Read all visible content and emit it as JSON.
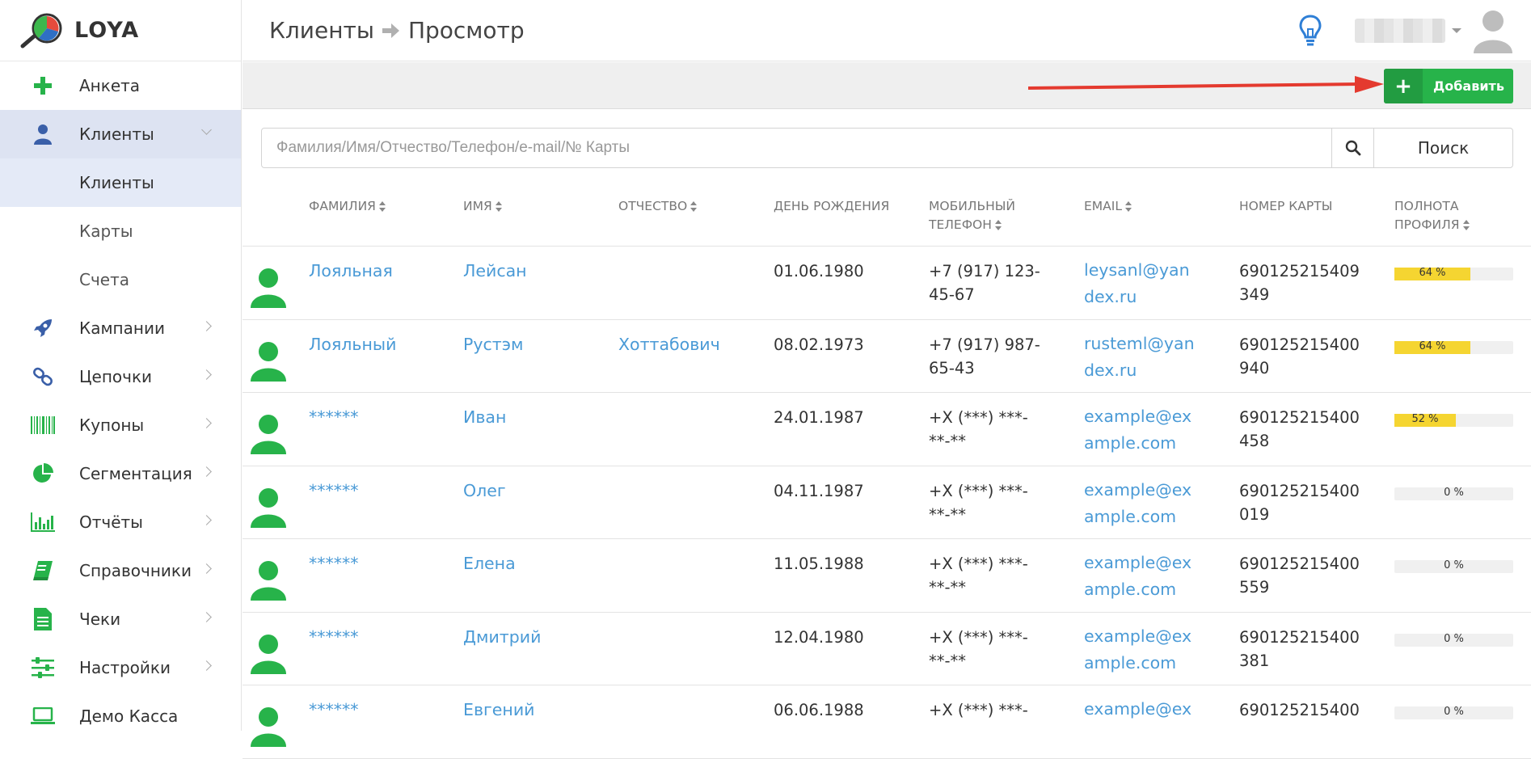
{
  "app": {
    "name": "LOYA"
  },
  "sidebar": {
    "items": [
      {
        "label": "Анкета",
        "icon": "plus-icon"
      },
      {
        "label": "Клиенты",
        "icon": "user-icon"
      },
      {
        "label": "Кампании",
        "icon": "rocket-icon"
      },
      {
        "label": "Цепочки",
        "icon": "chain-icon"
      },
      {
        "label": "Купоны",
        "icon": "barcode-icon"
      },
      {
        "label": "Сегментация",
        "icon": "pie-chart-icon"
      },
      {
        "label": "Отчёты",
        "icon": "bar-chart-icon"
      },
      {
        "label": "Справочники",
        "icon": "book-icon"
      },
      {
        "label": "Чеки",
        "icon": "receipt-icon"
      },
      {
        "label": "Настройки",
        "icon": "sliders-icon"
      },
      {
        "label": "Демо Касса",
        "icon": "laptop-icon"
      }
    ],
    "sub": [
      {
        "label": "Клиенты"
      },
      {
        "label": "Карты"
      },
      {
        "label": "Счета"
      }
    ]
  },
  "header": {
    "crumb1": "Клиенты",
    "crumb2": "Просмотр"
  },
  "toolbar": {
    "add_label": "Добавить"
  },
  "search": {
    "placeholder": "Фамилия/Имя/Отчество/Телефон/e-mail/№ Карты",
    "button": "Поиск"
  },
  "table": {
    "headers": {
      "lastname": "ФАМИЛИЯ",
      "firstname": "ИМЯ",
      "patronymic": "ОТЧЕСТВО",
      "birthday": "ДЕНЬ РОЖДЕНИЯ",
      "phone1": "МОБИЛЬНЫЙ",
      "phone2": "ТЕЛЕФОН",
      "email": "EMAIL",
      "card": "НОМЕР КАРТЫ",
      "profile1": "ПОЛНОТА",
      "profile2": "ПРОФИЛЯ"
    },
    "rows": [
      {
        "lastname": "Лояльная",
        "firstname": "Лейсан",
        "patronymic": "",
        "birthday": "01.06.1980",
        "phone1": "+7 (917) 123-",
        "phone2": "45-67",
        "email1": "leysanl@yan",
        "email2": "dex.ru",
        "card1": "690125215409",
        "card2": "349",
        "profile": 64,
        "profile_label": "64 %"
      },
      {
        "lastname": "Лояльный",
        "firstname": "Рустэм",
        "patronymic": "Хоттабович",
        "birthday": "08.02.1973",
        "phone1": "+7 (917) 987-",
        "phone2": "65-43",
        "email1": "rusteml@yan",
        "email2": "dex.ru",
        "card1": "690125215400",
        "card2": "940",
        "profile": 64,
        "profile_label": "64 %"
      },
      {
        "lastname": "******",
        "firstname": "Иван",
        "patronymic": "",
        "birthday": "24.01.1987",
        "phone1": "+X (***) ***-",
        "phone2": "**-**",
        "email1": "example@ex",
        "email2": "ample.com",
        "card1": "690125215400",
        "card2": "458",
        "profile": 52,
        "profile_label": "52 %"
      },
      {
        "lastname": "******",
        "firstname": "Олег",
        "patronymic": "",
        "birthday": "04.11.1987",
        "phone1": "+X (***) ***-",
        "phone2": "**-**",
        "email1": "example@ex",
        "email2": "ample.com",
        "card1": "690125215400",
        "card2": "019",
        "profile": 0,
        "profile_label": "0 %"
      },
      {
        "lastname": "******",
        "firstname": "Елена",
        "patronymic": "",
        "birthday": "11.05.1988",
        "phone1": "+X (***) ***-",
        "phone2": "**-**",
        "email1": "example@ex",
        "email2": "ample.com",
        "card1": "690125215400",
        "card2": "559",
        "profile": 0,
        "profile_label": "0 %"
      },
      {
        "lastname": "******",
        "firstname": "Дмитрий",
        "patronymic": "",
        "birthday": "12.04.1980",
        "phone1": "+X (***) ***-",
        "phone2": "**-**",
        "email1": "example@ex",
        "email2": "ample.com",
        "card1": "690125215400",
        "card2": "381",
        "profile": 0,
        "profile_label": "0 %"
      },
      {
        "lastname": "******",
        "firstname": "Евгений",
        "patronymic": "",
        "birthday": "06.06.1988",
        "phone1": "+X (***) ***-",
        "phone2": "",
        "email1": "example@ex",
        "email2": "",
        "card1": "690125215400",
        "card2": "",
        "profile": 0,
        "profile_label": "0 %"
      }
    ]
  },
  "colors": {
    "accent": "#4a9ad6",
    "success": "#27b34a",
    "progress": "#f5d531",
    "sidebar_active": "#dde3f2"
  }
}
